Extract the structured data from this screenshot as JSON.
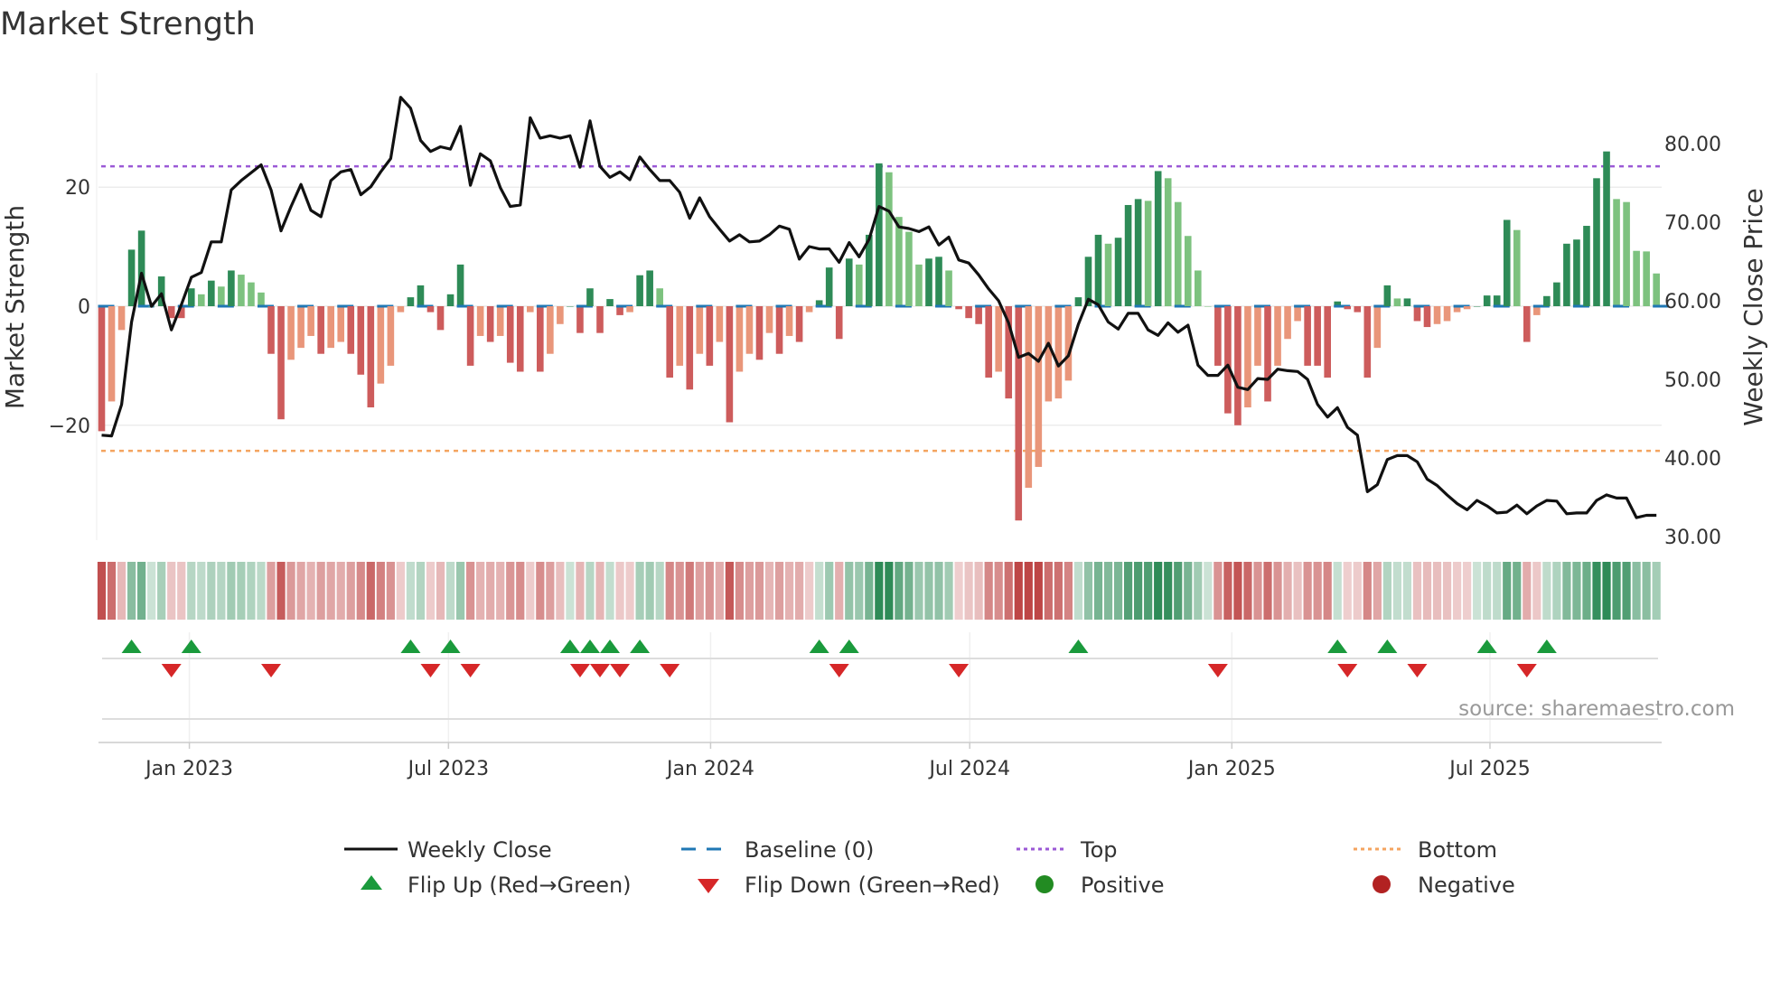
{
  "chart_data": {
    "type": "bar",
    "title": "Market Strength",
    "ylabel": "Market Strength",
    "y2label": "Weekly Close Price",
    "ylim": [
      -40,
      40
    ],
    "y2lim": [
      30,
      88
    ],
    "yticks": [
      {
        "v": 20,
        "label": "20"
      },
      {
        "v": 0,
        "label": "0"
      },
      {
        "v": -20,
        "label": "−20"
      }
    ],
    "y2ticks": [
      {
        "v": 80,
        "label": "80.00"
      },
      {
        "v": 70,
        "label": "70.00"
      },
      {
        "v": 60,
        "label": "60.00"
      },
      {
        "v": 50,
        "label": "50.00"
      },
      {
        "v": 40,
        "label": "40.00"
      },
      {
        "v": 30,
        "label": "30.00"
      }
    ],
    "xticks": [
      {
        "week": 8.8,
        "label": "Jan 2023"
      },
      {
        "week": 34.8,
        "label": "Jul 2023"
      },
      {
        "week": 61.1,
        "label": "Jan 2024"
      },
      {
        "week": 87.1,
        "label": "Jul 2024"
      },
      {
        "week": 113.4,
        "label": "Jan 2025"
      },
      {
        "week": 139.3,
        "label": "Jul 2025"
      }
    ],
    "top_level": 23.5,
    "bottom_level": -24.3,
    "strength": [
      -21,
      -16,
      -4,
      9.5,
      12.7,
      0,
      5,
      -2,
      -2,
      3,
      2,
      4.3,
      3.3,
      6,
      5.3,
      4,
      2.3,
      -8,
      -19,
      -9,
      -7,
      -5,
      -8,
      -7,
      -6,
      -8,
      -11.5,
      -17,
      -13,
      -10,
      -1,
      1.5,
      3.5,
      -1,
      -4,
      2,
      7,
      -10,
      -5,
      -6,
      -5,
      -9.5,
      -11,
      -1,
      -11,
      -8,
      -3,
      0,
      -4.5,
      3,
      -4.5,
      1.2,
      -1.5,
      -1,
      5.2,
      6,
      3,
      -12,
      -10,
      -14,
      -8,
      -10,
      -6,
      -19.5,
      -11,
      -8,
      -9,
      -4.5,
      -8,
      -5,
      -6,
      -1,
      1,
      6.5,
      -5.5,
      8,
      7,
      12,
      24,
      22.5,
      15,
      12.5,
      7,
      8,
      8.3,
      6,
      -0.5,
      -2,
      -3,
      -12,
      -11,
      -15.5,
      -36,
      -30.5,
      -27,
      -16,
      -15.5,
      -12.5,
      1.5,
      8.3,
      12,
      10.5,
      11.5,
      17,
      18,
      17.7,
      22.7,
      21.5,
      17.5,
      11.8,
      6,
      0,
      -10,
      -18,
      -20,
      -17,
      -10,
      -16,
      -10,
      -5.5,
      -2.5,
      -10,
      -10,
      -12,
      0.8,
      -0.5,
      -1,
      -12,
      -7,
      3.5,
      1.3,
      1.3,
      -2.5,
      -3.5,
      -3,
      -2.5,
      -1,
      -0.5,
      0,
      1.8,
      1.8,
      14.5,
      12.8,
      -6,
      -1.5,
      1.7,
      4,
      10.5,
      11.2,
      13.5,
      21.5,
      26,
      18,
      17.5,
      9.3,
      9.2,
      5.5
    ],
    "close": [
      42.9,
      42.8,
      46.8,
      57.3,
      63.5,
      59.3,
      60.9,
      56.3,
      59.5,
      63.0,
      63.6,
      67.5,
      67.5,
      74.1,
      75.3,
      76.3,
      77.3,
      74.1,
      68.9,
      72.0,
      74.8,
      71.5,
      70.7,
      75.3,
      76.4,
      76.7,
      73.5,
      74.5,
      76.4,
      78.1,
      85.9,
      84.5,
      80.4,
      79.0,
      79.6,
      79.3,
      82.2,
      74.7,
      78.7,
      77.8,
      74.4,
      72.0,
      72.2,
      83.3,
      80.7,
      81.0,
      80.7,
      81.0,
      77.0,
      82.9,
      77.1,
      75.7,
      76.4,
      75.4,
      78.3,
      76.7,
      75.3,
      75.3,
      73.8,
      70.5,
      73.1,
      70.7,
      69.1,
      67.6,
      68.4,
      67.5,
      67.6,
      68.4,
      69.5,
      69.1,
      65.3,
      66.9,
      66.6,
      66.6,
      64.9,
      67.4,
      65.6,
      67.8,
      72.0,
      71.4,
      69.4,
      69.2,
      68.8,
      69.4,
      67.1,
      68.1,
      65.2,
      64.8,
      63.3,
      61.5,
      60.0,
      57.2,
      52.8,
      53.3,
      52.3,
      54.6,
      51.7,
      53.0,
      57.0,
      60.2,
      59.5,
      57.3,
      56.4,
      58.4,
      58.4,
      56.3,
      55.6,
      57.2,
      56.0,
      56.9,
      51.8,
      50.5,
      50.5,
      51.8,
      49.0,
      48.7,
      50.1,
      50.0,
      51.3,
      51.1,
      51.0,
      50.0,
      46.8,
      45.2,
      46.4,
      43.9,
      42.9,
      35.7,
      36.6,
      39.8,
      40.3,
      40.3,
      39.5,
      37.3,
      36.5,
      35.3,
      34.2,
      33.4,
      34.6,
      33.9,
      33.0,
      33.1,
      34.0,
      32.9,
      33.9,
      34.6,
      34.5,
      32.9,
      33.0,
      33.0,
      34.6,
      35.3,
      34.9,
      34.9,
      32.4,
      32.7,
      32.7
    ],
    "flip_up_weeks": [
      3,
      9,
      31,
      35,
      47,
      49,
      51,
      54,
      72,
      75,
      98,
      124,
      129,
      139,
      145
    ],
    "flip_down_weeks": [
      7,
      17,
      33,
      37,
      48,
      50,
      52,
      57,
      74,
      86,
      112,
      125,
      132,
      143
    ],
    "legend": {
      "weekly_close": "Weekly Close",
      "baseline": "Baseline (0)",
      "top": "Top",
      "bottom": "Bottom",
      "flip_up": "Flip Up (Red→Green)",
      "flip_down": "Flip Down (Green→Red)",
      "positive": "Positive",
      "negative": "Negative"
    },
    "source": "source: sharemaestro.com",
    "colors": {
      "pos_strong": "#2e8b57",
      "pos_weak": "#7dc27f",
      "neg_strong": "#cd5c5c",
      "neg_weak": "#e9967a",
      "baseline": "#1f77b4",
      "top": "#9b59d6",
      "bottom": "#f4a460",
      "flip_up": "#1a9a3c",
      "flip_down": "#d62728",
      "positive": "#228b22",
      "negative": "#b22222",
      "line": "#111111"
    }
  }
}
